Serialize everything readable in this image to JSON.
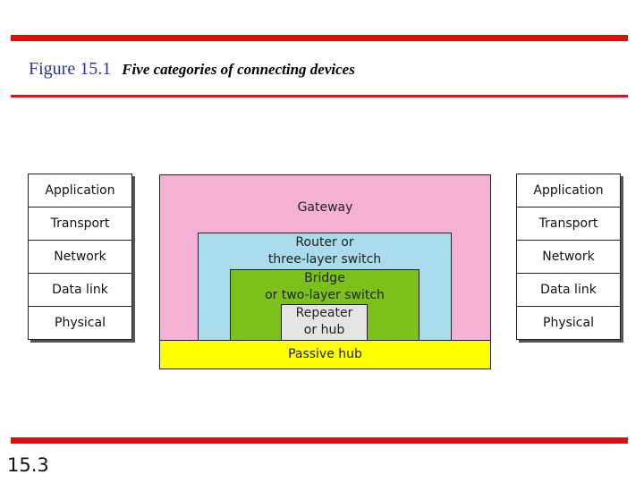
{
  "header": {
    "figure_number": "Figure 15.1",
    "caption": "Five categories of connecting devices"
  },
  "left_stack": {
    "layers": [
      "Application",
      "Transport",
      "Network",
      "Data link",
      "Physical"
    ]
  },
  "right_stack": {
    "layers": [
      "Application",
      "Transport",
      "Network",
      "Data link",
      "Physical"
    ]
  },
  "devices": {
    "gateway": "Gateway",
    "router_line1": "Router or",
    "router_line2": "three-layer switch",
    "bridge_line1": "Bridge",
    "bridge_line2": "or two-layer switch",
    "repeater_line1": "Repeater",
    "repeater_line2": "or hub",
    "passive_hub": "Passive hub"
  },
  "colors": {
    "gateway": "#f5b0d6",
    "router": "#a9dcec",
    "bridge": "#7cc11a",
    "repeater": "#e5e5e5",
    "passive_hub": "#ffff00",
    "rule": "#e60a0a",
    "figure_number": "#333399"
  },
  "footer": {
    "page_number": "15.3"
  }
}
